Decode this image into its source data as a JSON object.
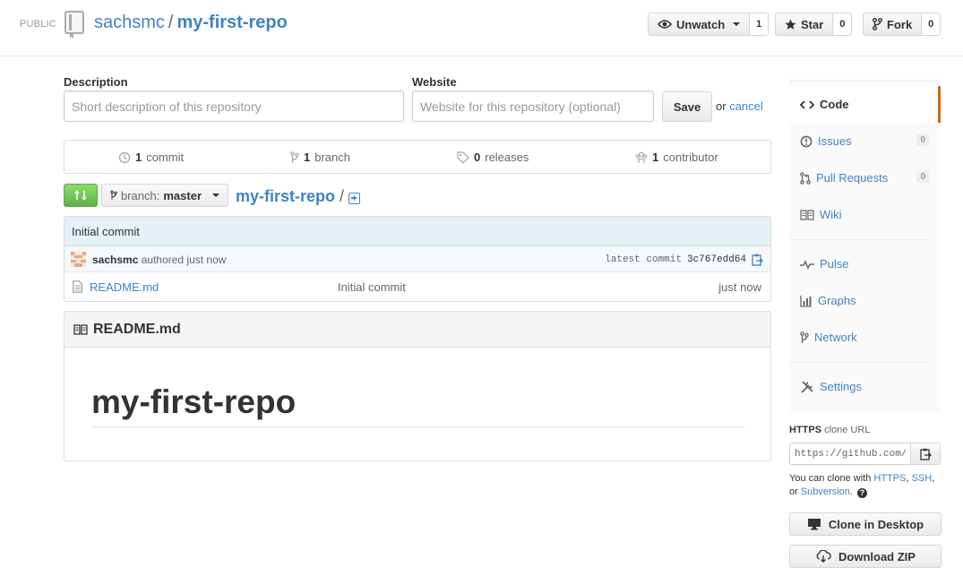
{
  "header": {
    "visibility": "PUBLIC",
    "owner": "sachsmc",
    "separator": "/",
    "repo_name": "my-first-repo",
    "unwatch_label": "Unwatch",
    "watch_count": "1",
    "star_label": "Star",
    "star_count": "0",
    "fork_label": "Fork",
    "fork_count": "0"
  },
  "edit_form": {
    "description_label": "Description",
    "description_placeholder": "Short description of this repository",
    "website_label": "Website",
    "website_placeholder": "Website for this repository (optional)",
    "save_label": "Save",
    "or_text": "or",
    "cancel_label": "cancel"
  },
  "numbers": {
    "commits_count": "1",
    "commits_label": "commit",
    "branches_count": "1",
    "branches_label": "branch",
    "releases_count": "0",
    "releases_label": "releases",
    "contributors_count": "1",
    "contributors_label": "contributor"
  },
  "file_nav": {
    "branch_prefix": "branch:",
    "branch_name": "master",
    "breadcrumb_repo": "my-first-repo",
    "breadcrumb_slash": "/"
  },
  "commit": {
    "title": "Initial commit",
    "author": "sachsmc",
    "authored_text": "authored just now",
    "latest_label": "latest commit",
    "sha": "3c767edd64"
  },
  "files": [
    {
      "name": "README.md",
      "message": "Initial commit",
      "age": "just now"
    }
  ],
  "readme": {
    "filename": "README.md",
    "heading": "my-first-repo"
  },
  "sidebar": {
    "items": [
      {
        "label": "Code",
        "count": ""
      },
      {
        "label": "Issues",
        "count": "0"
      },
      {
        "label": "Pull Requests",
        "count": "0"
      },
      {
        "label": "Wiki",
        "count": ""
      },
      {
        "label": "Pulse",
        "count": ""
      },
      {
        "label": "Graphs",
        "count": ""
      },
      {
        "label": "Network",
        "count": ""
      },
      {
        "label": "Settings",
        "count": ""
      }
    ]
  },
  "clone": {
    "protocol": "HTTPS",
    "label_suffix": "clone URL",
    "url": "https://github.com/sachsmc/my-first-repo.git",
    "help_prefix": "You can clone with",
    "https_link": "HTTPS",
    "comma": ",",
    "ssh_link": "SSH",
    "or_text": "or",
    "svn_link": "Subversion",
    "period": ".",
    "help_icon": "?",
    "clone_desktop_label": "Clone in Desktop",
    "download_zip_label": "Download ZIP"
  },
  "colors": {
    "link": "#4183c4",
    "accent_selected": "#d26911",
    "compare_green": "#60b044"
  }
}
